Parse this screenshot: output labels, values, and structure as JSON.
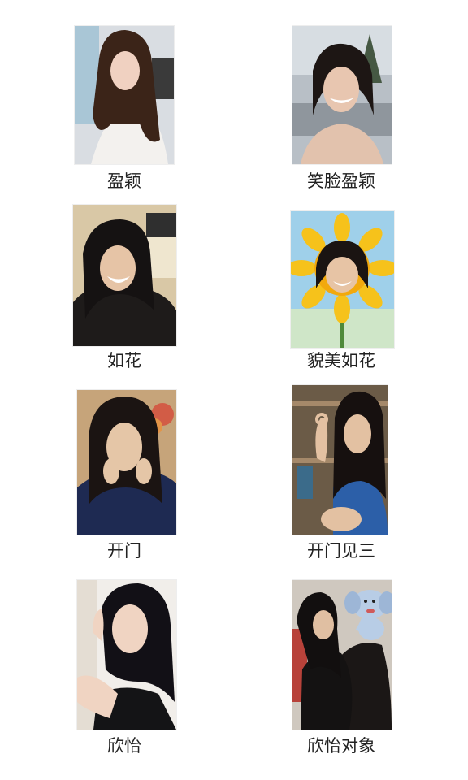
{
  "cells": [
    {
      "caption": "盈颖",
      "image": "photo of young woman with long hair in white top"
    },
    {
      "caption": "笑脸盈颖",
      "image": "photo of young woman laughing outdoors"
    },
    {
      "caption": "如花",
      "image": "photo of young woman with bangs laughing"
    },
    {
      "caption": "貌美如花",
      "image": "sunflower with woman's laughing face in center"
    },
    {
      "caption": "开门",
      "image": "young woman with hands on cheeks"
    },
    {
      "caption": "开门见三",
      "image": "young woman making OK hand sign"
    },
    {
      "caption": "欣怡",
      "image": "young woman with dark hair posing"
    },
    {
      "caption": "欣怡对象",
      "image": "young woman hugging another person, cartoon elephant sticker"
    }
  ]
}
